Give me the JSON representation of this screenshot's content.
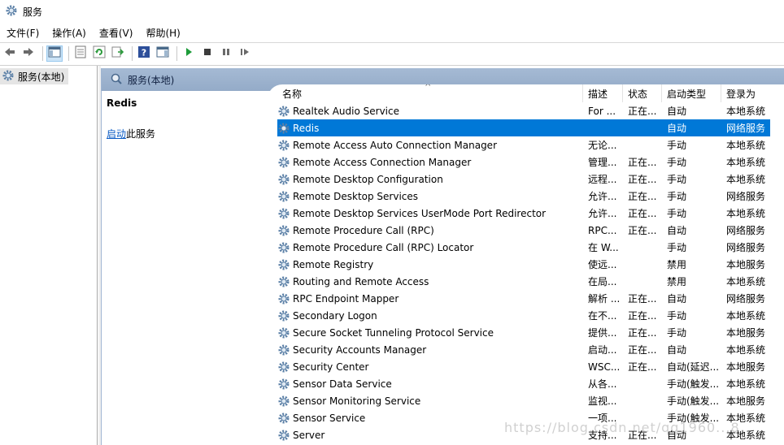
{
  "window": {
    "title": "服务"
  },
  "menu": [
    {
      "label": "文件(F)"
    },
    {
      "label": "操作(A)"
    },
    {
      "label": "查看(V)"
    },
    {
      "label": "帮助(H)"
    }
  ],
  "toolbar": {
    "buttons": [
      {
        "icon": "back-arrow-icon"
      },
      {
        "icon": "forward-arrow-icon"
      },
      {
        "icon": "show-console-tree-icon",
        "active": true
      },
      {
        "icon": "properties-sheet-icon"
      },
      {
        "icon": "refresh-icon"
      },
      {
        "icon": "export-list-icon"
      },
      {
        "icon": "help-icon"
      },
      {
        "icon": "show-action-pane-icon"
      },
      {
        "icon": "start-service-icon"
      },
      {
        "icon": "stop-service-icon"
      },
      {
        "icon": "pause-service-icon"
      },
      {
        "icon": "restart-service-icon"
      }
    ]
  },
  "tree": {
    "item_label": "服务(本地)"
  },
  "panel": {
    "header_title": "服务(本地)"
  },
  "description": {
    "service_name": "Redis",
    "start_link": "启动",
    "start_suffix": "此服务"
  },
  "list": {
    "columns": {
      "name": "名称",
      "desc": "描述",
      "status": "状态",
      "startup": "启动类型",
      "logon": "登录为"
    },
    "sort_glyph": "^",
    "rows": [
      {
        "name": "Realtek Audio Service",
        "desc": "For ...",
        "status": "正在...",
        "startup": "自动",
        "logon": "本地系统"
      },
      {
        "name": "Redis",
        "desc": "",
        "status": "",
        "startup": "自动",
        "logon": "网络服务",
        "selected": true
      },
      {
        "name": "Remote Access Auto Connection Manager",
        "desc": "无论...",
        "status": "",
        "startup": "手动",
        "logon": "本地系统"
      },
      {
        "name": "Remote Access Connection Manager",
        "desc": "管理...",
        "status": "正在...",
        "startup": "手动",
        "logon": "本地系统"
      },
      {
        "name": "Remote Desktop Configuration",
        "desc": "远程...",
        "status": "正在...",
        "startup": "手动",
        "logon": "本地系统"
      },
      {
        "name": "Remote Desktop Services",
        "desc": "允许...",
        "status": "正在...",
        "startup": "手动",
        "logon": "网络服务"
      },
      {
        "name": "Remote Desktop Services UserMode Port Redirector",
        "desc": "允许...",
        "status": "正在...",
        "startup": "手动",
        "logon": "本地系统"
      },
      {
        "name": "Remote Procedure Call (RPC)",
        "desc": "RPC...",
        "status": "正在...",
        "startup": "自动",
        "logon": "网络服务"
      },
      {
        "name": "Remote Procedure Call (RPC) Locator",
        "desc": "在 W...",
        "status": "",
        "startup": "手动",
        "logon": "网络服务"
      },
      {
        "name": "Remote Registry",
        "desc": "使远...",
        "status": "",
        "startup": "禁用",
        "logon": "本地服务"
      },
      {
        "name": "Routing and Remote Access",
        "desc": "在局...",
        "status": "",
        "startup": "禁用",
        "logon": "本地系统"
      },
      {
        "name": "RPC Endpoint Mapper",
        "desc": "解析 ...",
        "status": "正在...",
        "startup": "自动",
        "logon": "网络服务"
      },
      {
        "name": "Secondary Logon",
        "desc": "在不...",
        "status": "正在...",
        "startup": "手动",
        "logon": "本地系统"
      },
      {
        "name": "Secure Socket Tunneling Protocol Service",
        "desc": "提供...",
        "status": "正在...",
        "startup": "手动",
        "logon": "本地服务"
      },
      {
        "name": "Security Accounts Manager",
        "desc": "启动...",
        "status": "正在...",
        "startup": "自动",
        "logon": "本地系统"
      },
      {
        "name": "Security Center",
        "desc": "WSC...",
        "status": "正在...",
        "startup": "自动(延迟...",
        "logon": "本地服务"
      },
      {
        "name": "Sensor Data Service",
        "desc": "从各...",
        "status": "",
        "startup": "手动(触发...",
        "logon": "本地系统"
      },
      {
        "name": "Sensor Monitoring Service",
        "desc": "监视...",
        "status": "",
        "startup": "手动(触发...",
        "logon": "本地服务"
      },
      {
        "name": "Sensor Service",
        "desc": "一项...",
        "status": "",
        "startup": "手动(触发...",
        "logon": "本地系统"
      },
      {
        "name": "Server",
        "desc": "支持...",
        "status": "正在...",
        "startup": "自动",
        "logon": "本地系统"
      }
    ]
  },
  "watermark": "https://blog.csdn.net/qq1960...8"
}
